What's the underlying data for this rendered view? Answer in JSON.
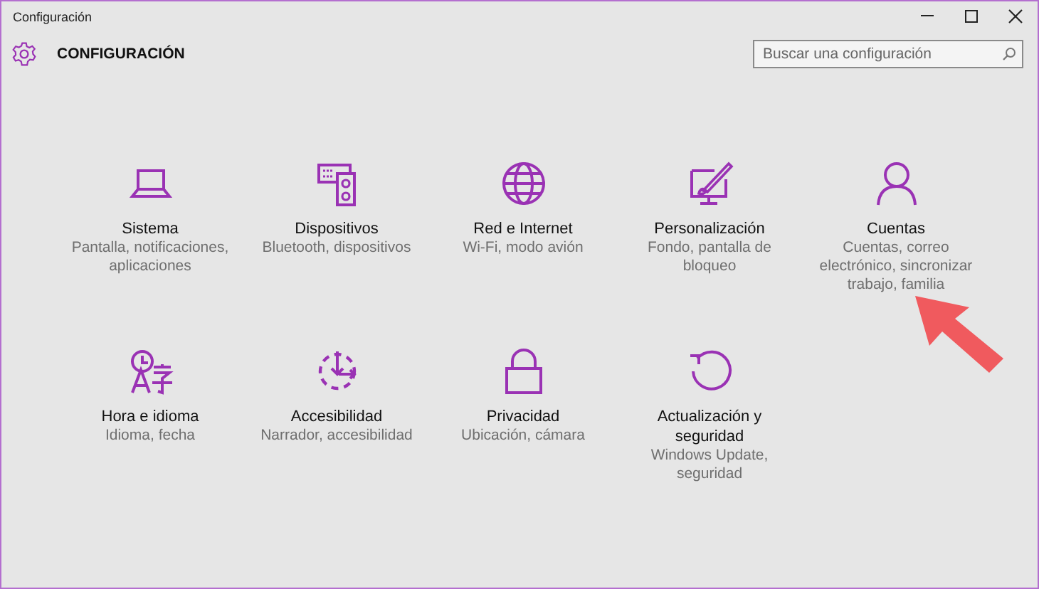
{
  "window": {
    "title": "Configuración"
  },
  "header": {
    "title": "CONFIGURACIÓN"
  },
  "search": {
    "placeholder": "Buscar una configuración"
  },
  "categories": [
    {
      "kind": "laptop",
      "title": "Sistema",
      "description": "Pantalla, notificaciones, aplicaciones"
    },
    {
      "kind": "devices",
      "title": "Dispositivos",
      "description": "Bluetooth, dispositivos"
    },
    {
      "kind": "globe",
      "title": "Red e Internet",
      "description": "Wi-Fi, modo avión"
    },
    {
      "kind": "paint",
      "title": "Personalización",
      "description": "Fondo, pantalla de bloqueo"
    },
    {
      "kind": "person",
      "title": "Cuentas",
      "description": "Cuentas, correo electrónico, sincronizar trabajo, familia"
    },
    {
      "kind": "language",
      "title": "Hora e idioma",
      "description": "Idioma, fecha"
    },
    {
      "kind": "access",
      "title": "Accesibilidad",
      "description": "Narrador, accesibilidad"
    },
    {
      "kind": "lock",
      "title": "Privacidad",
      "description": "Ubicación, cámara"
    },
    {
      "kind": "update",
      "title": "Actualización y seguridad",
      "description": "Windows Update, seguridad"
    }
  ]
}
